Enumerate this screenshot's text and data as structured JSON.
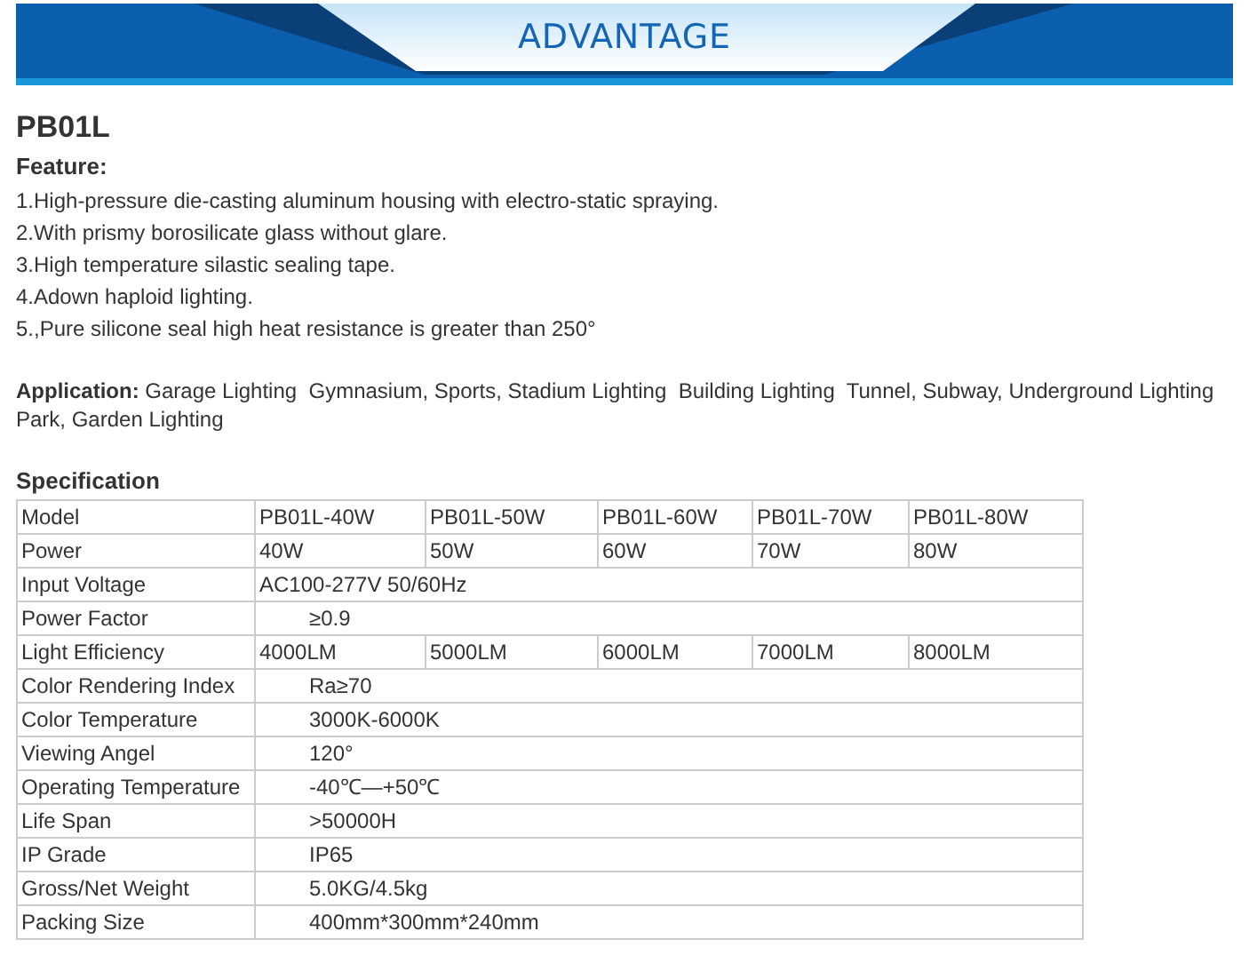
{
  "banner": {
    "title": "ADVANTAGE"
  },
  "product": {
    "title": "PB01L"
  },
  "features": {
    "heading": "Feature:",
    "items": [
      "1.High-pressure die-casting aluminum housing with electro-static spraying.",
      "2.With prismy borosilicate glass without glare.",
      "3.High temperature silastic sealing tape.",
      "4.Adown haploid lighting.",
      "5.,Pure silicone seal high heat resistance is greater than 250°"
    ]
  },
  "application": {
    "label": "Application:",
    "text": "Garage Lighting  Gymnasium, Sports, Stadium Lighting  Building Lighting  Tunnel, Subway, Underground Lighting Park, Garden Lighting"
  },
  "specification": {
    "heading": "Specification",
    "rows": [
      {
        "kind": "cells",
        "label": "Model",
        "values": [
          "PB01L-40W",
          "PB01L-50W",
          "PB01L-60W",
          "PB01L-70W",
          "PB01L-80W"
        ]
      },
      {
        "kind": "cells",
        "label": "Power",
        "values": [
          "40W",
          "50W",
          "60W",
          "70W",
          "80W"
        ]
      },
      {
        "kind": "span",
        "label": "Input Voltage",
        "values": [
          "AC100-277V 50/60Hz"
        ]
      },
      {
        "kind": "indented",
        "label": "Power Factor",
        "values": [
          "≥0.9"
        ]
      },
      {
        "kind": "cells",
        "label": "Light Efficiency",
        "values": [
          "4000LM",
          "5000LM",
          "6000LM",
          "7000LM",
          "8000LM"
        ]
      },
      {
        "kind": "indented",
        "label": "Color Rendering Index",
        "values": [
          "Ra≥70"
        ]
      },
      {
        "kind": "indented",
        "label": "Color Temperature",
        "values": [
          "3000K-6000K"
        ]
      },
      {
        "kind": "indented",
        "label": "Viewing Angel",
        "values": [
          "120°"
        ]
      },
      {
        "kind": "indented",
        "label": "Operating Temperature",
        "values": [
          "-40℃—+50℃"
        ]
      },
      {
        "kind": "indented",
        "label": "Life Span",
        "values": [
          ">50000H"
        ]
      },
      {
        "kind": "indented",
        "label": "IP Grade",
        "values": [
          "IP65"
        ]
      },
      {
        "kind": "indented",
        "label": "Gross/Net Weight",
        "values": [
          "5.0KG/4.5kg"
        ]
      },
      {
        "kind": "indented",
        "label": "Packing Size",
        "values": [
          "400mm*300mm*240mm"
        ]
      }
    ]
  }
}
